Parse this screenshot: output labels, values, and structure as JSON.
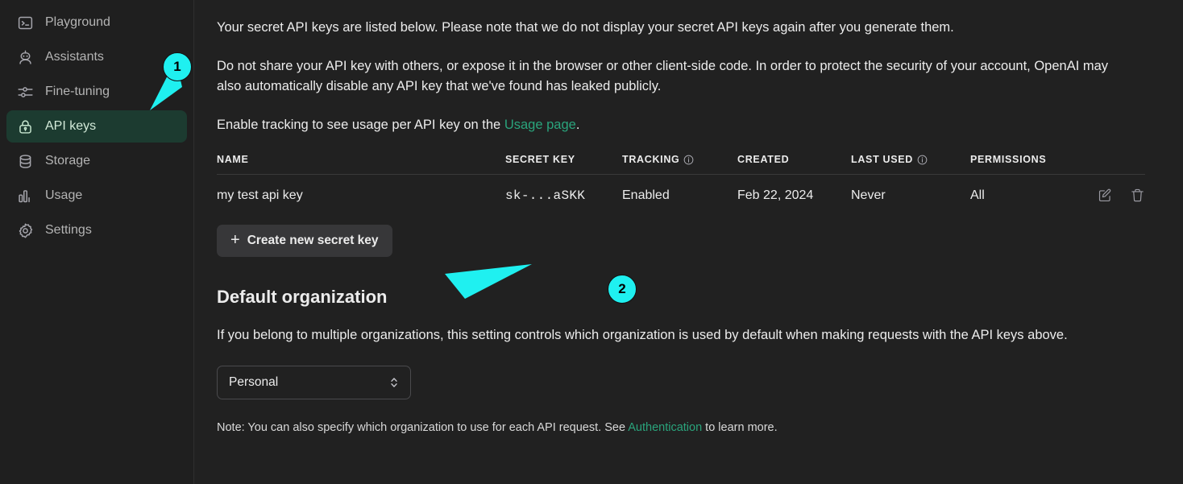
{
  "colors": {
    "background": "#212121",
    "sidebar_bg": "#1f1f1f",
    "active_nav_bg": "#1c3b30",
    "active_nav_text": "#d3ead9",
    "link": "#2aa47c",
    "annotation": "#1ff0f0",
    "button_bg": "#373739"
  },
  "sidebar": {
    "items": [
      {
        "label": "Playground",
        "icon": "terminal-icon",
        "active": false
      },
      {
        "label": "Assistants",
        "icon": "robot-icon",
        "active": false
      },
      {
        "label": "Fine-tuning",
        "icon": "sliders-icon",
        "active": false
      },
      {
        "label": "API keys",
        "icon": "lock-icon",
        "active": true
      },
      {
        "label": "Storage",
        "icon": "database-icon",
        "active": false
      },
      {
        "label": "Usage",
        "icon": "bar-chart-icon",
        "active": false
      },
      {
        "label": "Settings",
        "icon": "gear-icon",
        "active": false
      }
    ]
  },
  "main": {
    "paragraph_1": "Your secret API keys are listed below. Please note that we do not display your secret API keys again after you generate them.",
    "paragraph_2": "Do not share your API key with others, or expose it in the browser or other client-side code. In order to protect the security of your account, OpenAI may also automatically disable any API key that we've found has leaked publicly.",
    "paragraph_3_prefix": "Enable tracking to see usage per API key on the ",
    "paragraph_3_link": "Usage page",
    "paragraph_3_suffix": ".",
    "table": {
      "columns": [
        {
          "label": "NAME",
          "info": false
        },
        {
          "label": "SECRET KEY",
          "info": false
        },
        {
          "label": "TRACKING",
          "info": true
        },
        {
          "label": "CREATED",
          "info": false
        },
        {
          "label": "LAST USED",
          "info": true
        },
        {
          "label": "PERMISSIONS",
          "info": false
        }
      ],
      "rows": [
        {
          "name": "my test api key",
          "secret_key": "sk-...aSKK",
          "tracking": "Enabled",
          "created": "Feb 22, 2024",
          "last_used": "Never",
          "permissions": "All",
          "actions": [
            "edit-icon",
            "delete-icon"
          ]
        }
      ]
    },
    "create_button": {
      "icon": "plus-icon",
      "label": "Create new secret key"
    },
    "default_org": {
      "heading": "Default organization",
      "description": "If you belong to multiple organizations, this setting controls which organization is used by default when making requests with the API keys above.",
      "select_value": "Personal",
      "note_prefix": "Note: You can also specify which organization to use for each API request. See ",
      "note_link": "Authentication",
      "note_suffix": " to learn more."
    }
  },
  "annotations": [
    {
      "number": "1",
      "target": "sidebar-item-api-keys"
    },
    {
      "number": "2",
      "target": "create-new-secret-key-button"
    }
  ]
}
